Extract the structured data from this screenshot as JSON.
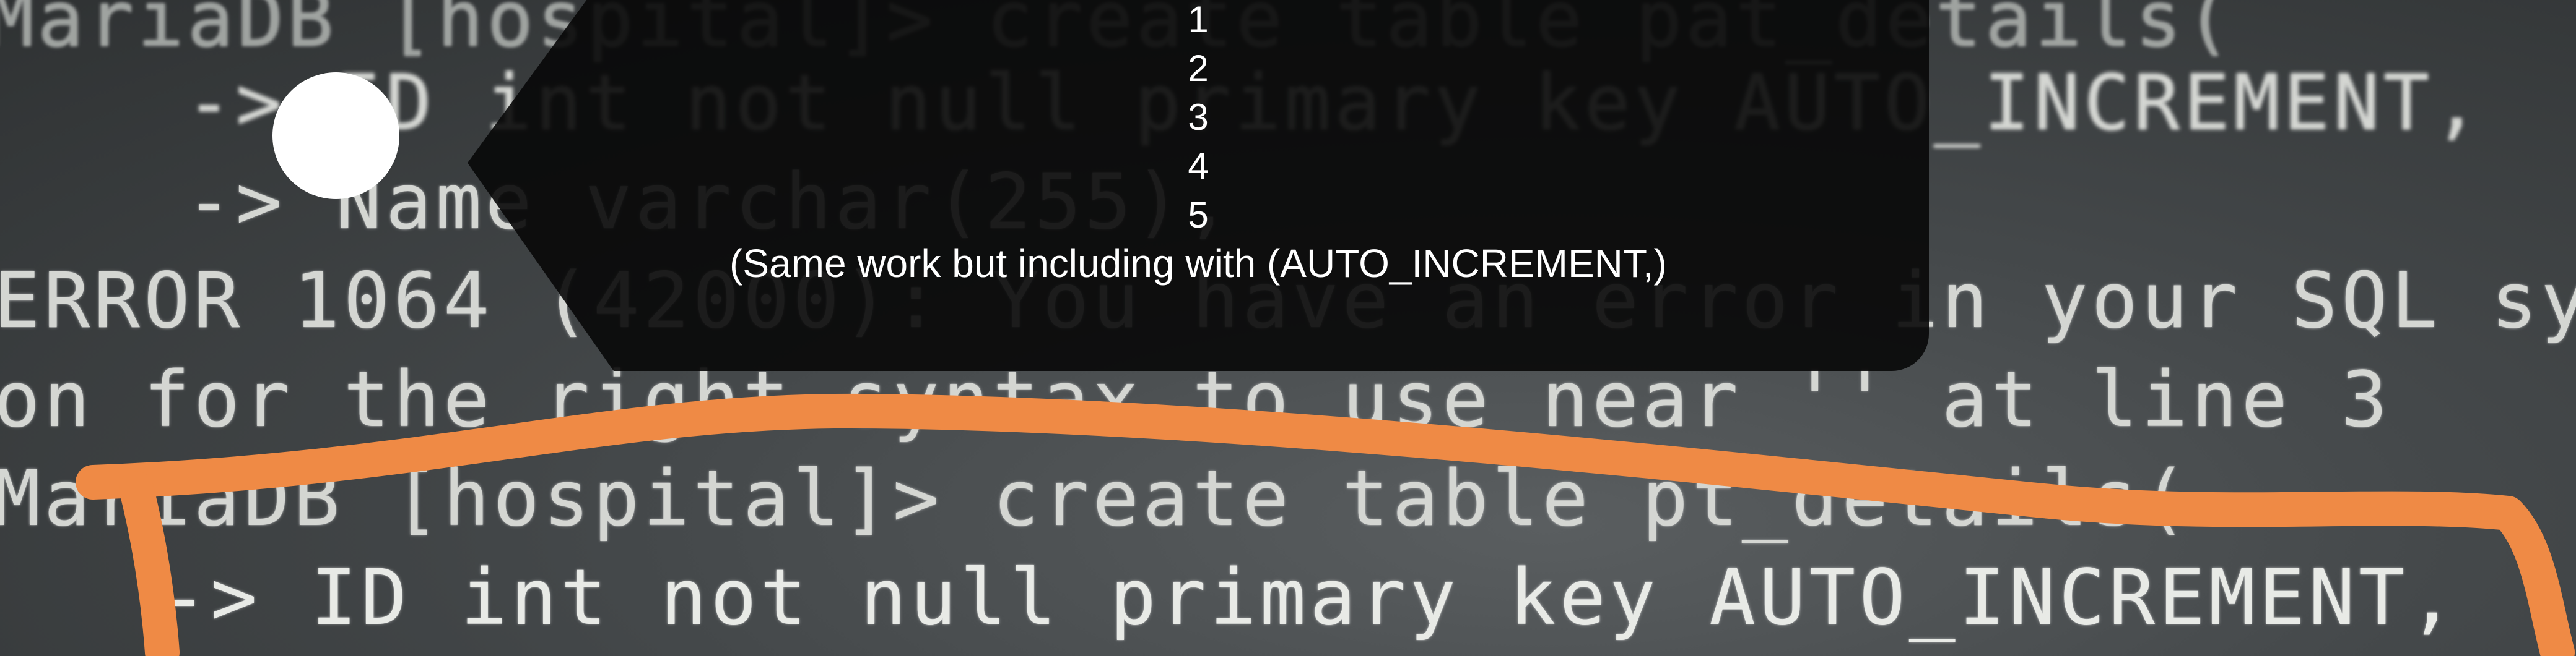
{
  "terminal": {
    "lines": [
      "MariaDB [hospital]> create table pat_details(",
      "-> ID int not null primary key AUTO_INCREMENT,",
      "-> Name varchar(255),",
      "ERROR 1064 (42000): You have an error in your SQL sy",
      "on for the right syntax to use near '' at line 3",
      "MariaDB [hospital]> create table pt_details(",
      "-> ID int not null primary key AUTO_INCREMENT,"
    ]
  },
  "callout": {
    "numbers": [
      "1",
      "2",
      "3",
      "4",
      "5"
    ],
    "note": "(Same work but including with (AUTO_INCREMENT,)"
  },
  "colors": {
    "annotation_stroke": "#ef8a45",
    "terminal_text": "#d4d6d2",
    "callout_bg": "#0a0a0a"
  }
}
